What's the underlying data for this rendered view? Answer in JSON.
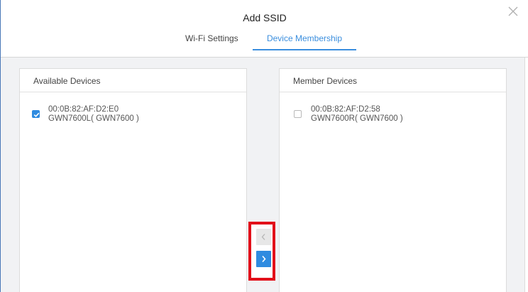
{
  "dialog": {
    "title": "Add SSID",
    "close_icon": "close-icon"
  },
  "tabs": [
    {
      "label": "Wi-Fi Settings",
      "active": false
    },
    {
      "label": "Device Membership",
      "active": true
    }
  ],
  "colors": {
    "accent": "#3a8ede",
    "highlight_border": "#e2101a",
    "content_bg": "#f1f2f4"
  },
  "available_devices": {
    "header": "Available Devices",
    "items": [
      {
        "mac": "00:0B:82:AF:D2:E0",
        "model": "GWN7600L( GWN7600 )",
        "checked": true
      }
    ]
  },
  "member_devices": {
    "header": "Member Devices",
    "items": [
      {
        "mac": "00:0B:82:AF:D2:58",
        "model": "GWN7600R( GWN7600 )",
        "checked": false
      }
    ]
  },
  "transfer": {
    "move_left_icon": "chevron-left-icon",
    "move_right_icon": "chevron-right-icon"
  }
}
